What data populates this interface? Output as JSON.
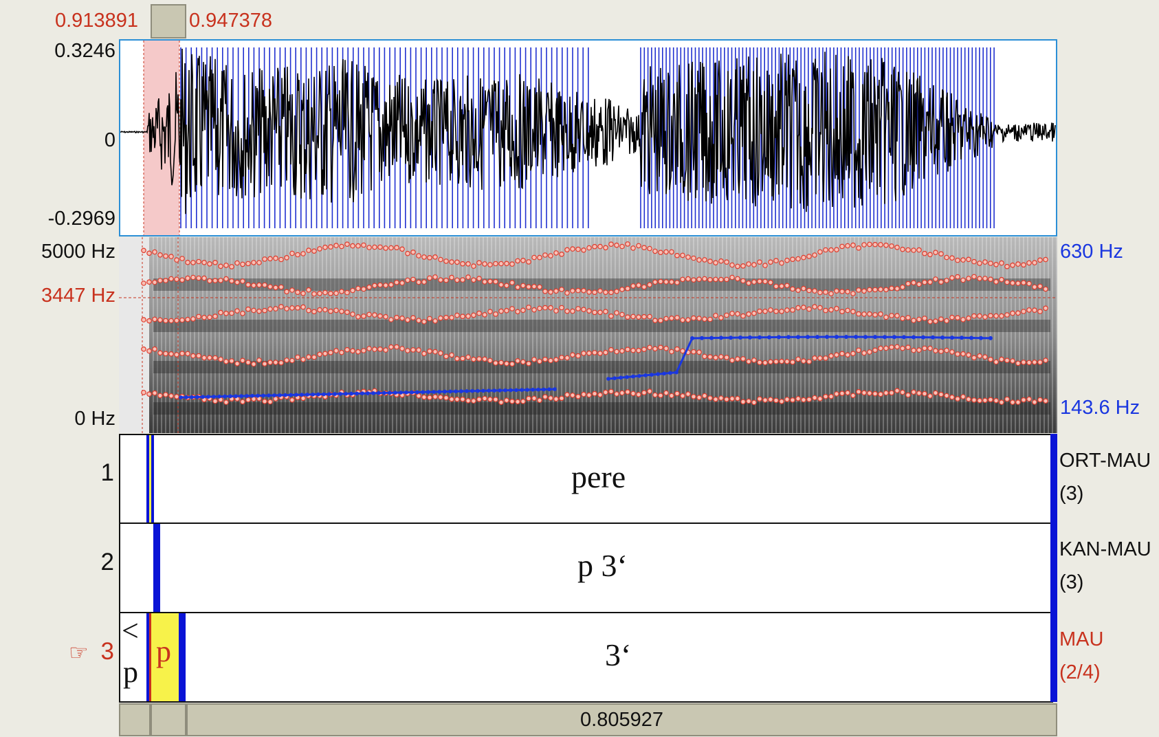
{
  "selection": {
    "start": "0.913891",
    "end": "0.947378"
  },
  "waveform": {
    "ymax": "0.3246",
    "yzero": "0",
    "ymin": "-0.2969"
  },
  "spectrogram": {
    "fmax": "5000 Hz",
    "cursor_freq": "3447 Hz",
    "fmin": "0 Hz",
    "pitch_max": "630 Hz",
    "pitch_min": "143.6 Hz"
  },
  "tiers": [
    {
      "number": "1",
      "name": "ORT-MAU",
      "count": "(3)",
      "text": "pere"
    },
    {
      "number": "2",
      "name": "KAN-MAU",
      "count": "(3)",
      "text": "p 3‘"
    },
    {
      "number": "3",
      "name": "MAU",
      "count": "(2/4)",
      "text": "3‘",
      "left_text_top": "<",
      "left_text_bottom": "p",
      "selected_text": "p",
      "pointer": "☞"
    }
  ],
  "bottom": {
    "visible_duration": "0.805927"
  },
  "colors": {
    "selection": "#c8321e",
    "boundary": "#0a14d6",
    "pitch": "#1a37e0",
    "formant": "#e03a2a",
    "interval_selected": "#f7f24a"
  }
}
